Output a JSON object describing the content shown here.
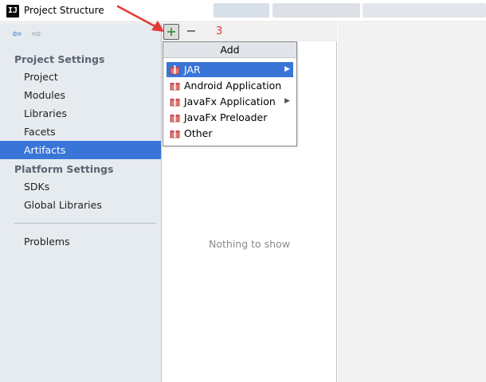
{
  "window": {
    "title": "Project Structure",
    "app_icon": "IJ"
  },
  "nav": {
    "back_icon": "back-arrow-icon",
    "forward_icon": "forward-arrow-icon"
  },
  "sidebar": {
    "project_settings_header": "Project Settings",
    "project_settings_items": [
      {
        "label": "Project"
      },
      {
        "label": "Modules"
      },
      {
        "label": "Libraries"
      },
      {
        "label": "Facets"
      },
      {
        "label": "Artifacts",
        "selected": true
      }
    ],
    "platform_settings_header": "Platform Settings",
    "platform_settings_items": [
      {
        "label": "SDKs"
      },
      {
        "label": "Global Libraries"
      }
    ],
    "other_items": [
      {
        "label": "Problems"
      }
    ]
  },
  "toolbar": {
    "step_number": "3",
    "add_symbol": "+",
    "remove_symbol": "−"
  },
  "popup": {
    "title": "Add",
    "items": [
      {
        "label": "JAR",
        "submenu": true,
        "active": true
      },
      {
        "label": "Android Application",
        "submenu": false
      },
      {
        "label": "JavaFx Application",
        "submenu": true
      },
      {
        "label": "JavaFx Preloader",
        "submenu": false
      },
      {
        "label": "Other",
        "submenu": false
      }
    ]
  },
  "middle": {
    "empty_text": "Nothing to show"
  },
  "colors": {
    "selection": "#3875d7",
    "sidebar_bg": "#e6ebf0",
    "annotation_red": "#e53935",
    "add_green": "#3d9a3d"
  }
}
